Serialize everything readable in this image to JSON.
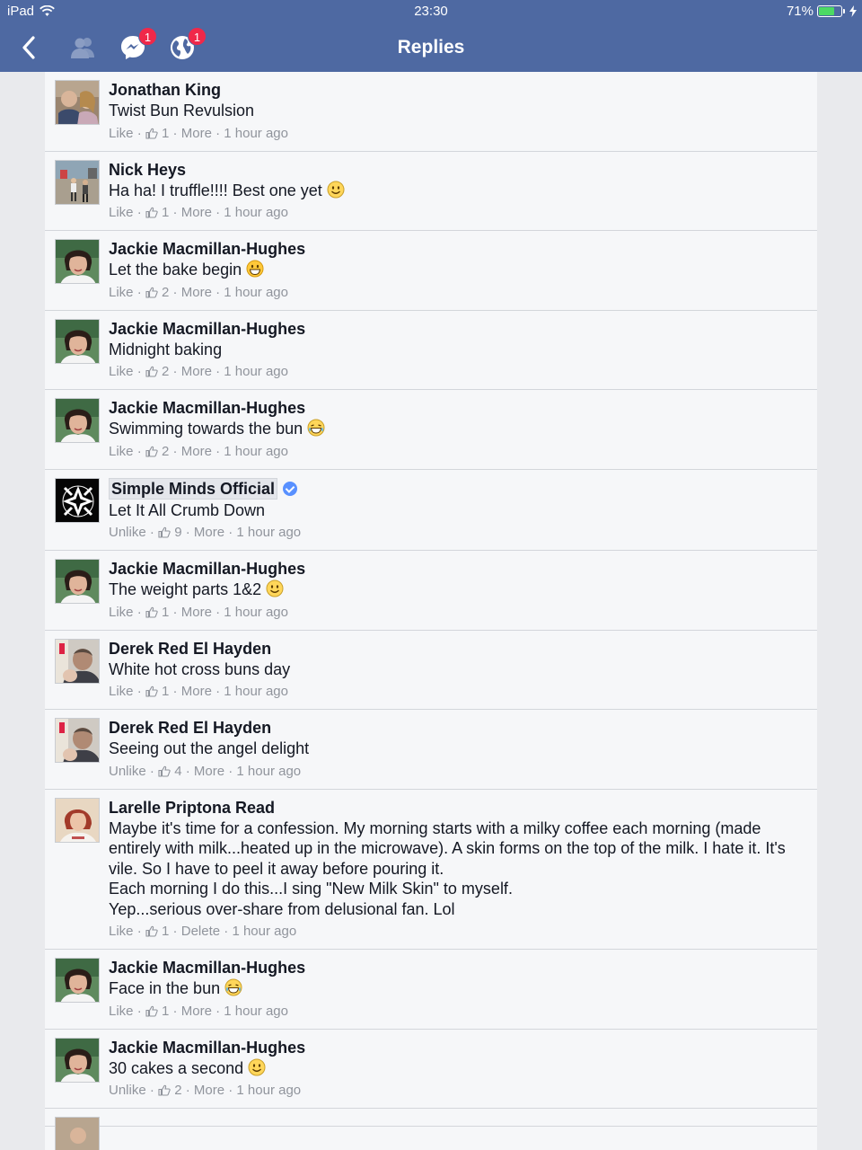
{
  "status": {
    "carrier": "iPad",
    "time": "23:30",
    "battery": "71%",
    "battery_level": 0.71
  },
  "nav": {
    "title": "Replies",
    "messenger_badge": "1",
    "globe_badge": "1"
  },
  "replies": [
    {
      "author": "Jonathan King",
      "text": "Twist Bun Revulsion",
      "emoji": "",
      "action": "Like",
      "likes": "1",
      "more": "More",
      "time": "1 hour ago"
    },
    {
      "author": "Nick Heys",
      "text": "Ha ha! I truffle!!!! Best one yet",
      "emoji": "smile-icon",
      "action": "Like",
      "likes": "1",
      "more": "More",
      "time": "1 hour ago"
    },
    {
      "author": "Jackie Macmillan-Hughes",
      "text": "Let the bake begin",
      "emoji": "grin-icon",
      "action": "Like",
      "likes": "2",
      "more": "More",
      "time": "1 hour ago"
    },
    {
      "author": "Jackie Macmillan-Hughes",
      "text": "Midnight baking",
      "emoji": "",
      "action": "Like",
      "likes": "2",
      "more": "More",
      "time": "1 hour ago"
    },
    {
      "author": "Jackie Macmillan-Hughes",
      "text": "Swimming towards the bun",
      "emoji": "laugh-icon",
      "action": "Like",
      "likes": "2",
      "more": "More",
      "time": "1 hour ago"
    },
    {
      "author": "Simple Minds Official",
      "text": "Let It All Crumb Down",
      "emoji": "",
      "action": "Unlike",
      "likes": "9",
      "more": "More",
      "time": "1 hour ago",
      "verified": true
    },
    {
      "author": "Jackie Macmillan-Hughes",
      "text": "The weight parts 1&2",
      "emoji": "smile-icon",
      "action": "Like",
      "likes": "1",
      "more": "More",
      "time": "1 hour ago"
    },
    {
      "author": "Derek Red El Hayden",
      "text": "White hot cross buns day",
      "emoji": "",
      "action": "Like",
      "likes": "1",
      "more": "More",
      "time": "1 hour ago"
    },
    {
      "author": "Derek Red El Hayden",
      "text": "Seeing out the angel delight",
      "emoji": "",
      "action": "Unlike",
      "likes": "4",
      "more": "More",
      "time": "1 hour ago"
    },
    {
      "author": "Larelle Priptona Read",
      "text": "Maybe it's time for a confession. My morning starts with a milky coffee each morning (made entirely with milk...heated up in the microwave). A skin forms on the top of the milk. I hate it. It's vile. So I have to peel it away before pouring it.\nEach morning I do this...I sing \"New Milk Skin\" to myself.\nYep...serious over-share from delusional fan. Lol",
      "emoji": "",
      "action": "Like",
      "likes": "1",
      "more": "Delete",
      "time": "1 hour ago"
    },
    {
      "author": "Jackie Macmillan-Hughes",
      "text": "Face in the bun",
      "emoji": "laugh-icon",
      "action": "Like",
      "likes": "1",
      "more": "More",
      "time": "1 hour ago"
    },
    {
      "author": "Jackie Macmillan-Hughes",
      "text": "30 cakes a second",
      "emoji": "smile-icon",
      "action": "Unlike",
      "likes": "2",
      "more": "More",
      "time": "1 hour ago"
    },
    {
      "author": "",
      "text": "",
      "emoji": "",
      "action": "",
      "likes": "",
      "more": "",
      "time": ""
    }
  ]
}
